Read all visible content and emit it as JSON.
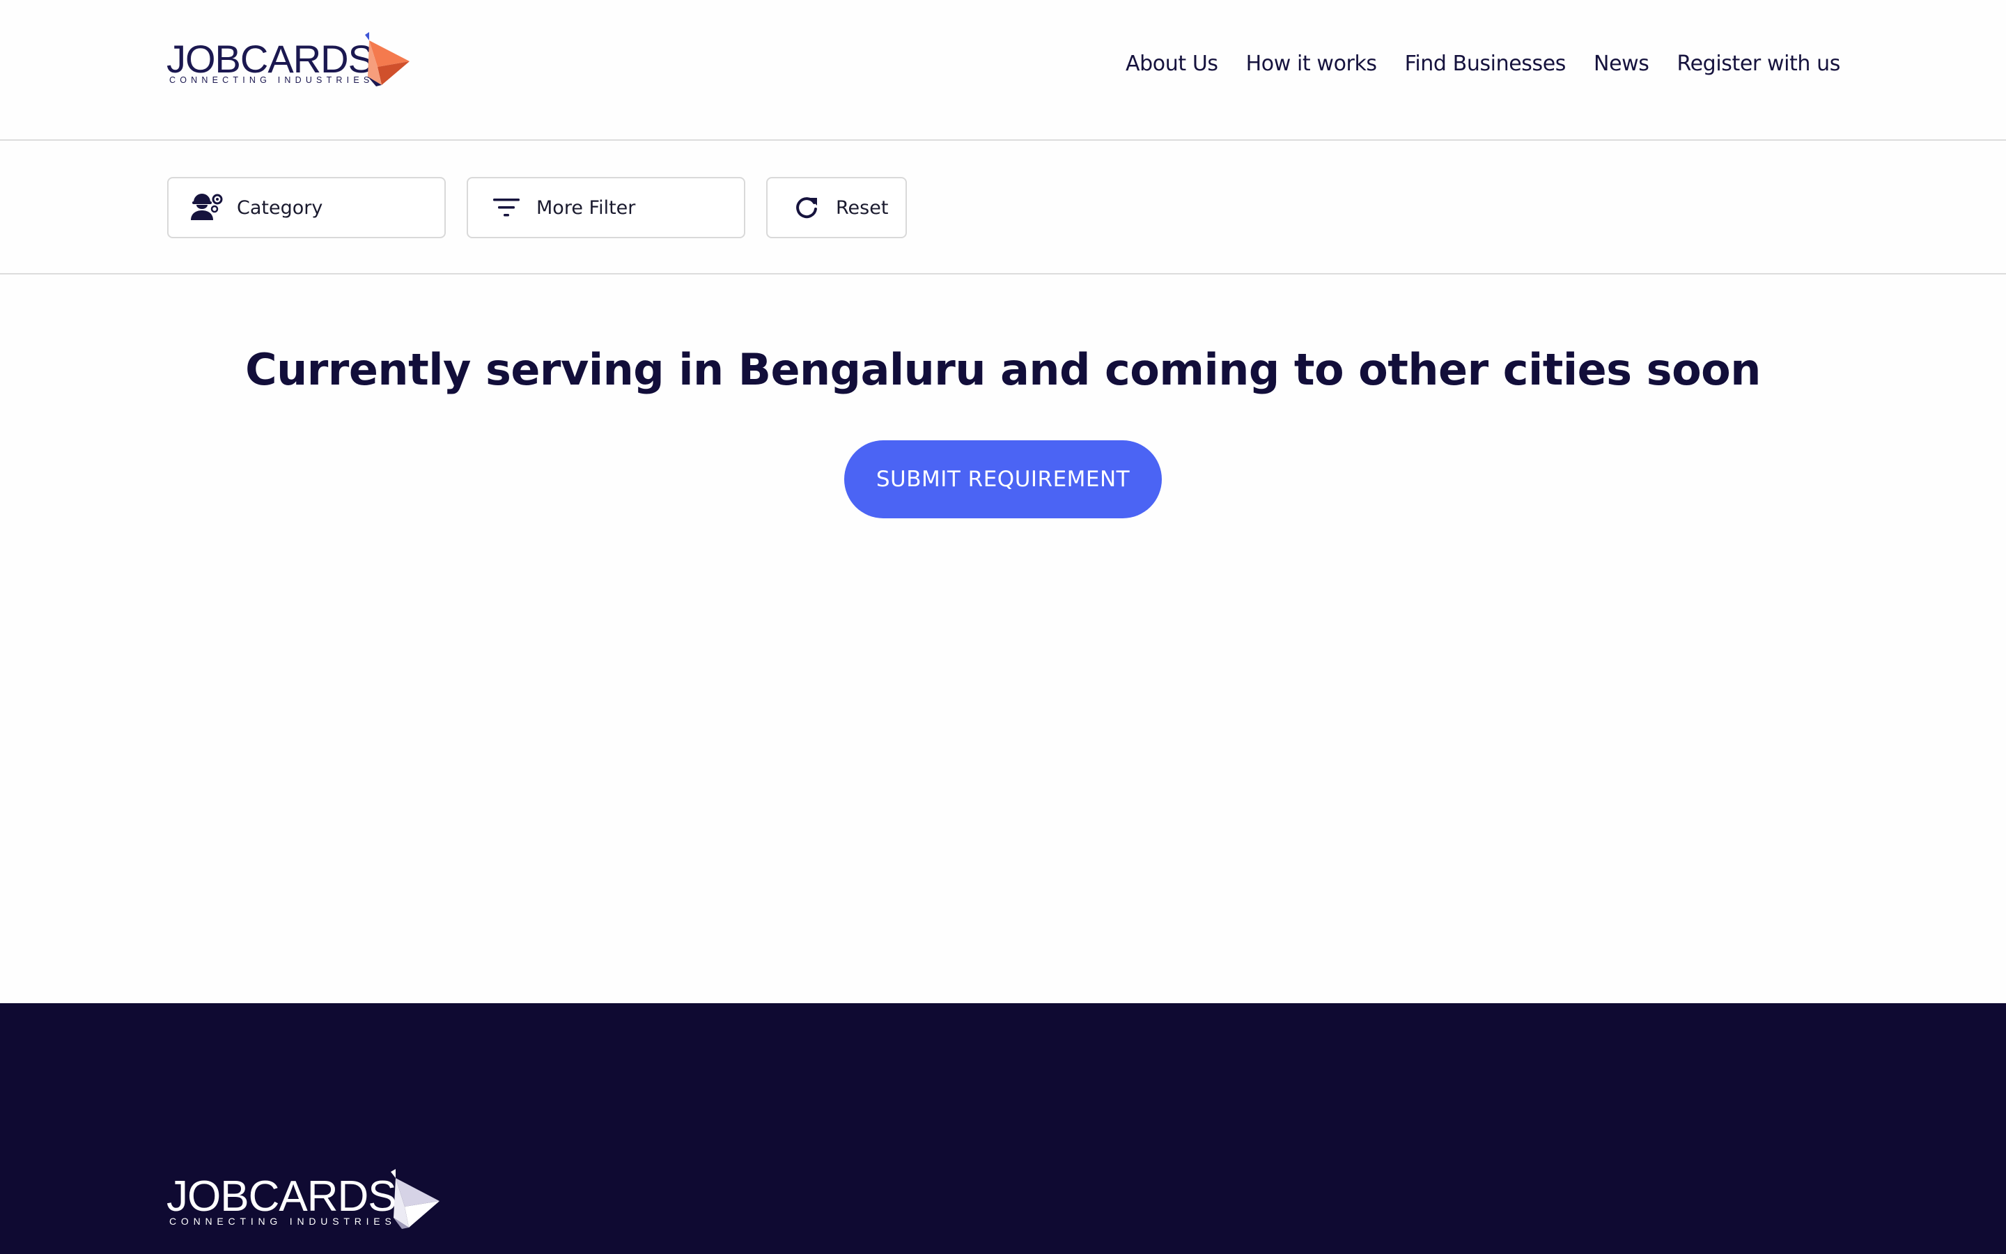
{
  "header": {
    "logo": {
      "name": "JOBCARDS",
      "tagline": "CONNECTING INDUSTRIES"
    },
    "nav": [
      {
        "label": "About Us"
      },
      {
        "label": "How it works"
      },
      {
        "label": "Find Businesses"
      },
      {
        "label": "News"
      },
      {
        "label": "Register with us"
      }
    ]
  },
  "filters": {
    "category": {
      "label": "Category",
      "icon": "worker-gear-icon"
    },
    "more_filter": {
      "label": "More Filter",
      "icon": "filter-lines-icon"
    },
    "reset": {
      "label": "Reset",
      "icon": "refresh-icon"
    }
  },
  "main": {
    "headline": "Currently serving in Bengaluru and coming to other cities soon",
    "submit_label": "SUBMIT REQUIREMENT"
  },
  "footer": {
    "logo": {
      "name": "JOBCARDS",
      "tagline": "CONNECTING INDUSTRIES"
    }
  },
  "colors": {
    "brand_navy": "#0f0a32",
    "accent_blue": "#4b64f4",
    "logo_orange": "#f47a4e",
    "text_dark": "#120e3a"
  }
}
